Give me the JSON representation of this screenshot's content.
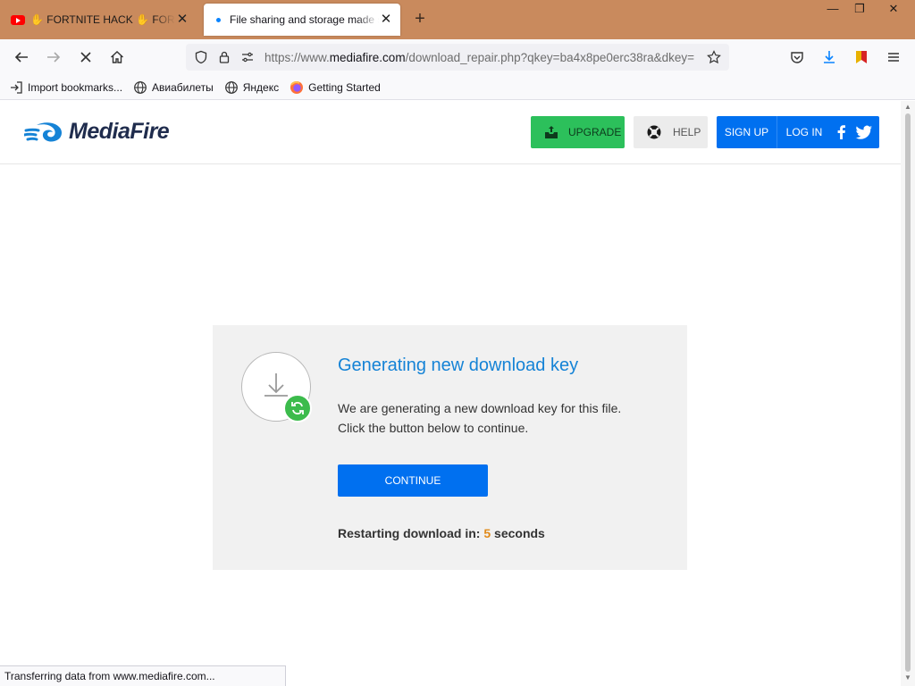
{
  "browser": {
    "tabs": [
      {
        "title": "✋ FORTNITE HACK ✋ FORTNITE",
        "active": false
      },
      {
        "title": "File sharing and storage made simple",
        "active": true
      }
    ],
    "new_tab": "+",
    "window_controls": {
      "minimize": "—",
      "restore": "❐",
      "close": "✕"
    },
    "url": {
      "prefix": "https://www.",
      "domain": "mediafire.com",
      "path": "/download_repair.php?qkey=ba4x8pe0erc38ra&dkey="
    },
    "bookmarks": [
      {
        "label": "Import bookmarks...",
        "icon": "import-icon"
      },
      {
        "label": "Авиабилеты",
        "icon": "globe-icon"
      },
      {
        "label": "Яндекс",
        "icon": "globe-icon"
      },
      {
        "label": "Getting Started",
        "icon": "firefox-icon"
      }
    ],
    "status_text": "Transferring data from www.mediafire.com..."
  },
  "page": {
    "logo_text": "MediaFire",
    "header": {
      "upgrade_label": "UPGRADE",
      "help_label": "HELP",
      "signup_label": "SIGN UP",
      "login_label": "LOG IN"
    },
    "card": {
      "title": "Generating new download key",
      "line1": "We are generating a new download key for this file.",
      "line2": "Click the button below to continue.",
      "button_label": "CONTINUE",
      "restart_prefix": "Restarting download in:",
      "countdown": "5",
      "restart_suffix": "seconds"
    }
  },
  "colors": {
    "tabbar": "#c98a5d",
    "brand_blue": "#0070f0",
    "upgrade_green": "#2cc05b",
    "title_blue": "#1583d6",
    "countdown_orange": "#e08a1a"
  }
}
